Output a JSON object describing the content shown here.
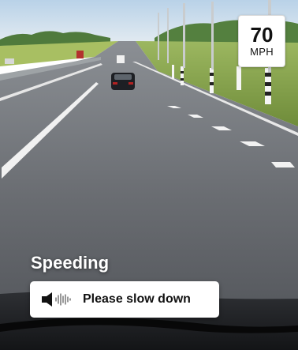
{
  "speed_sign": {
    "value": "70",
    "unit": "MPH"
  },
  "alert": {
    "title": "Speeding",
    "message": "Please slow down",
    "icon": "speaker-icon"
  },
  "colors": {
    "sky": "#cfe0ee",
    "road": "#5b5e63",
    "grass": "#8aa84e",
    "banner_bg": "#ffffff",
    "text_dark": "#111111"
  }
}
